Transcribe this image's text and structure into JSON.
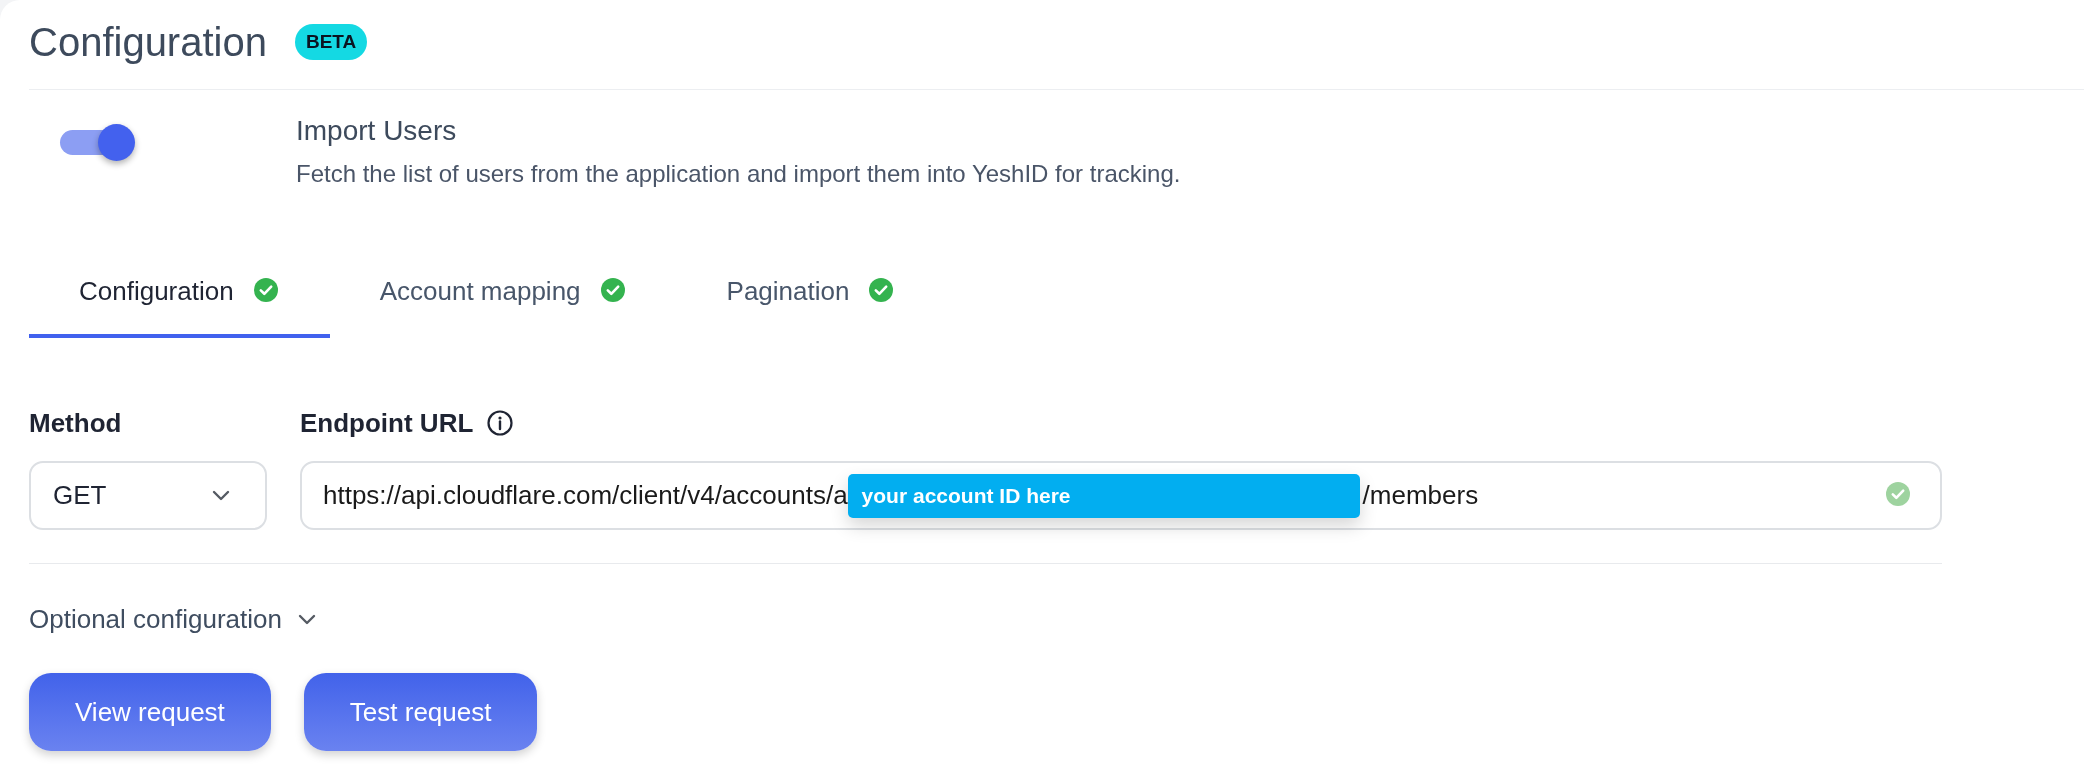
{
  "header": {
    "title": "Configuration",
    "badge": "BETA"
  },
  "import_users": {
    "on": true,
    "title": "Import Users",
    "description": "Fetch the list of users from the application and import them into YeshID for tracking."
  },
  "tabs": [
    {
      "label": "Configuration",
      "selected": true,
      "complete": true
    },
    {
      "label": "Account mapping",
      "selected": false,
      "complete": true
    },
    {
      "label": "Pagination",
      "selected": false,
      "complete": true
    }
  ],
  "method": {
    "label": "Method",
    "value": "GET"
  },
  "endpoint": {
    "label": "Endpoint URL",
    "value_start": "https://api.cloudflare.com/client/v4/accounts/a",
    "overlay": "your account ID here",
    "value_end": "/members",
    "valid": true
  },
  "optional": {
    "label": "Optional configuration",
    "expanded": false
  },
  "buttons": [
    "View request",
    "Test request"
  ]
}
